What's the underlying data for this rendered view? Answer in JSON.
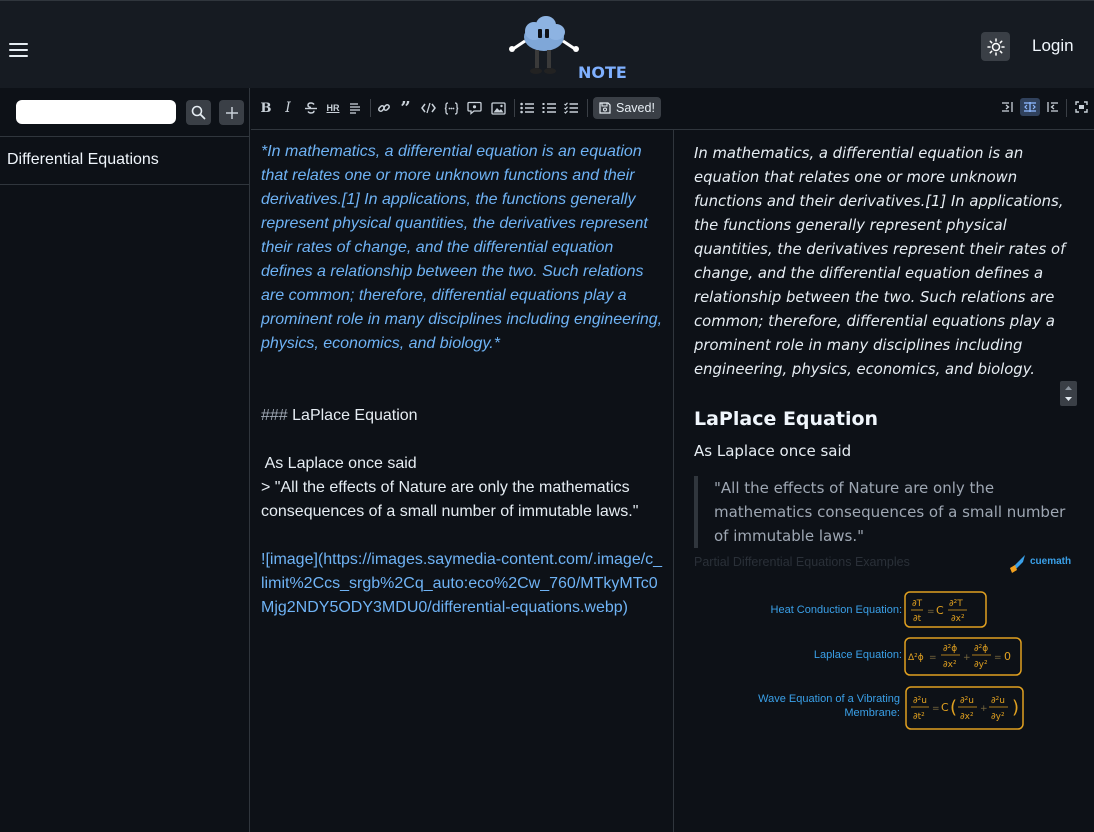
{
  "header": {
    "logo_text": "NOTES",
    "login_label": "Login"
  },
  "sidebar": {
    "search_placeholder": "",
    "notes": [
      {
        "title": "Differential Equations"
      }
    ]
  },
  "toolbar": {
    "bold": "B",
    "italic": "I",
    "hr": "HR",
    "saved_label": "Saved!"
  },
  "editor": {
    "paragraph": "*In mathematics, a differential equation is an equation that relates one or more unknown functions and their derivatives.[1] In applications, the functions generally represent physical quantities, the derivatives represent their rates of change, and the differential equation defines a relationship between the two. Such relations are common; therefore, differential equations play a prominent role in many disciplines including engineering, physics, economics, and biology.*",
    "heading_marker": "### ",
    "heading": "LaPlace Equation",
    "said": " As Laplace once said",
    "quote": "> \"All the effects of Nature are only the mathematics consequences of a small number of immutable laws.\"",
    "image_md": "![image](https://images.saymedia-content.com/.image/c_limit%2Ccs_srgb%2Cq_auto:eco%2Cw_760/MTkyMTc0Mjg2NDY5ODY3MDU0/differential-equations.webp)"
  },
  "preview": {
    "paragraph": "In mathematics, a differential equation is an equation that relates one or more unknown functions and their derivatives.[1] In applications, the functions generally represent physical quantities, the derivatives represent their rates of change, and the differential equation defines a relationship between the two. Such relations are common; therefore, differential equations play a prominent role in many disciplines including engineering, physics, economics, and biology.",
    "heading": "LaPlace Equation",
    "said": "As Laplace once said",
    "quote": "\"All the effects of Nature are only the mathematics consequences of a small number of immutable laws.\"",
    "image": {
      "title": "Partial Differential Equations Examples",
      "brand": "cuemath",
      "rows": [
        {
          "label": "Heat Conduction Equation:"
        },
        {
          "label": "Laplace Equation:"
        },
        {
          "label_line1": "Wave Equation of a Vibrating",
          "label_line2": "Membrane:"
        }
      ]
    }
  },
  "colors": {
    "accent": "#6fb3f5",
    "equation_border": "#e0a020",
    "brand_blue": "#3aa0e8"
  }
}
